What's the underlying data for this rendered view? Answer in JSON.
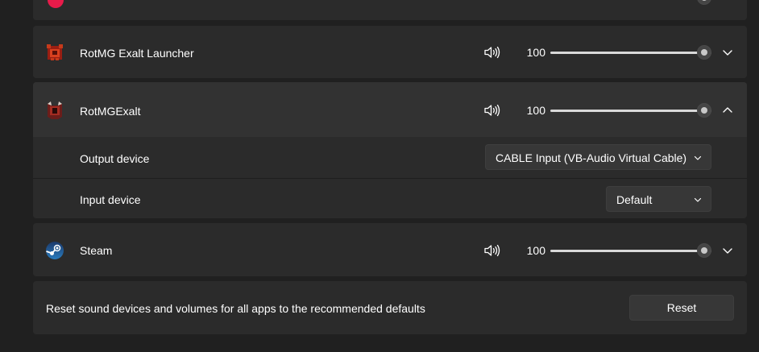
{
  "apps": [
    {
      "name": "RotMG Exalt Launcher",
      "volume": "100",
      "level": 1.0,
      "icon": "rotmg-launcher-icon",
      "expanded": false
    },
    {
      "name": "RotMGExalt",
      "volume": "100",
      "level": 1.0,
      "icon": "rotmg-exalt-icon",
      "expanded": true
    },
    {
      "name": "Steam",
      "volume": "100",
      "level": 1.0,
      "icon": "steam-icon",
      "expanded": false
    }
  ],
  "rotmgexalt_devices": {
    "output_label": "Output device",
    "output_value": "CABLE Input (VB-Audio Virtual Cable)",
    "input_label": "Input device",
    "input_value": "Default"
  },
  "reset": {
    "text": "Reset sound devices and volumes for all apps to the recommended defaults",
    "button_label": "Reset"
  },
  "colors": {
    "background": "#202020",
    "card": "#2b2b2b",
    "card_expanded_header": "#323232",
    "button": "#373737",
    "slider_track": "#d9d9d9"
  }
}
